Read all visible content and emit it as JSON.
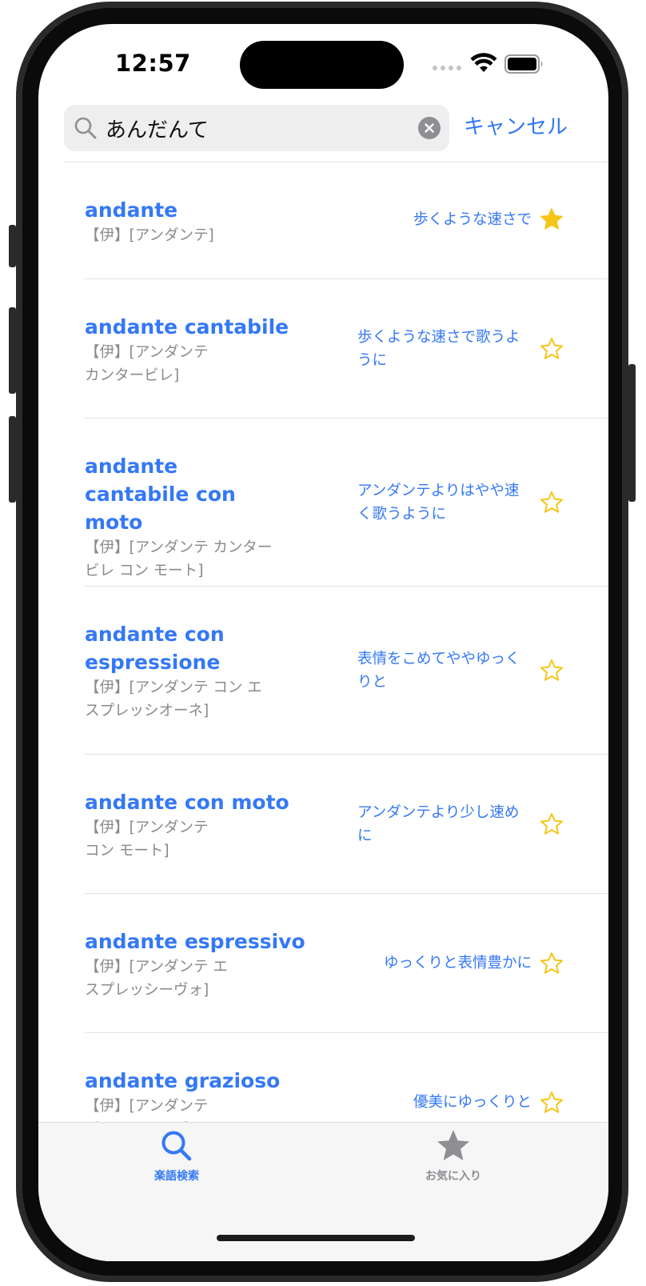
{
  "status_bar": {
    "time": "12:57"
  },
  "search": {
    "query": "あんだんて",
    "cancel_label": "キャンセル"
  },
  "results": [
    {
      "term": "andante",
      "reading": "【伊】[アンダンテ]",
      "meaning": "歩くような速さで",
      "favorite": true
    },
    {
      "term": "andante cantabile",
      "reading": "【伊】[アンダンテ カンタービレ]",
      "meaning": "歩くような速さで歌うように",
      "favorite": false
    },
    {
      "term": "andante cantabile con moto",
      "reading": "【伊】[アンダンテ カンタービレ コン モート]",
      "meaning": "アンダンテよりはやや速く歌うように",
      "favorite": false
    },
    {
      "term": "andante con espressione",
      "reading": "【伊】[アンダンテ コン エスプレッシオーネ]",
      "meaning": "表情をこめてややゆっくりと",
      "favorite": false
    },
    {
      "term": "andante con moto",
      "reading": "【伊】[アンダンテ コン モート]",
      "meaning": "アンダンテより少し速めに",
      "favorite": false
    },
    {
      "term": "andante espressivo",
      "reading": "【伊】[アンダンテ エスプレッシーヴォ]",
      "meaning": "ゆっくりと表情豊かに",
      "favorite": false
    },
    {
      "term": "andante grazioso",
      "reading": "【伊】[アンダンテ グラツィオーゾ]",
      "meaning": "優美にゆっくりと",
      "favorite": false
    }
  ],
  "tabs": [
    {
      "label": "楽語検索",
      "icon": "search-icon",
      "selected": true
    },
    {
      "label": "お気に入り",
      "icon": "star-icon",
      "selected": false
    }
  ],
  "colors": {
    "accent": "#3478f6",
    "star": "#f5c518",
    "secondary_text": "#8a8a8e",
    "inactive_tab": "#8e8e93"
  }
}
